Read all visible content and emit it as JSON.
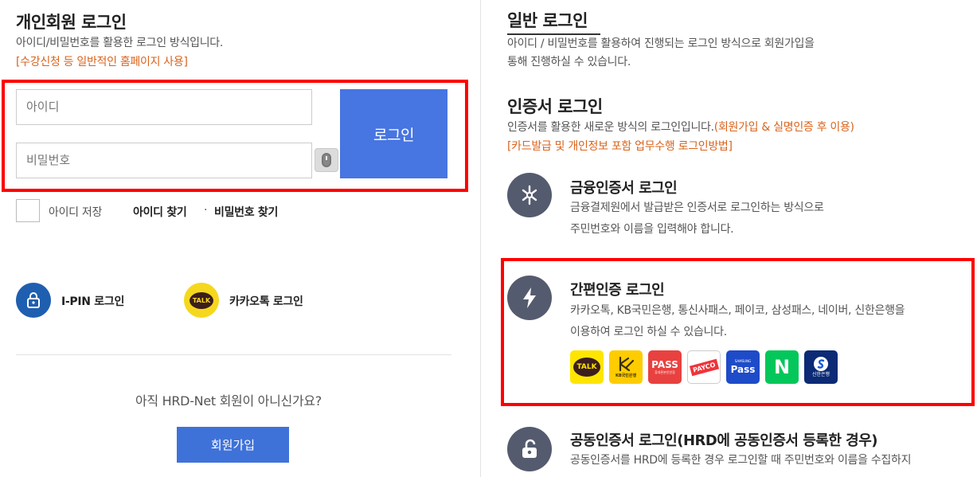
{
  "left": {
    "title": "개인회원 로그인",
    "desc": "아이디/비밀번호를 활용한 로그인 방식입니다.",
    "note": "[수강신청 등 일반적인 홈페이지 사용]",
    "id_placeholder": "아이디",
    "pw_placeholder": "비밀번호",
    "login_label": "로그인",
    "save_id": "아이디 저장",
    "find_id": "아이디 찾기",
    "separator": "·",
    "find_pw": "비밀번호 찾기",
    "ipin_label": "I-PIN 로그인",
    "kakao_label": "카카오톡 로그인",
    "kakao_icon_text": "TALK",
    "not_member": "아직 HRD-Net 회원이 아니신가요?",
    "join_label": "회원가입"
  },
  "right": {
    "general_title": "일반 로그인",
    "general_desc_1": "아이디 / 비밀번호를 활용하여 진행되는 로그인 방식으로 회원가입을",
    "general_desc_2": "통해 진행하실 수 있습니다.",
    "cert_title": "인증서 로그인",
    "cert_desc": "인증서를 활용한 새로운 방식의 로그인입니다.",
    "cert_note": "(회원가입 & 실명인증 후 이용)",
    "cert_note2": "[카드발급 및 개인정보 포함 업무수행 로그인방법]",
    "finance_title": "금융인증서 로그인",
    "finance_desc_1": "금융결제원에서 발급받은 인증서로 로그인하는 방식으로",
    "finance_desc_2": "주민번호와 이름을 입력해야 합니다.",
    "simple_title": "간편인증 로그인",
    "simple_desc_1": "카카오톡, KB국민은행, 통신사패스, 페이코, 삼성패스, 네이버, 신한은행을",
    "simple_desc_2": "이용하여 로그인 하실 수 있습니다.",
    "apps": [
      {
        "name": "kakao",
        "text": "TALK",
        "color": "#fee500"
      },
      {
        "name": "kb",
        "text": "KB국민은행",
        "color": "#ffcc00"
      },
      {
        "name": "pass",
        "text": "PASS",
        "sub": "휴대폰본인인증",
        "color": "#e8413f"
      },
      {
        "name": "payco",
        "text": "PAYCO",
        "color": "#ffffff"
      },
      {
        "name": "samsung-pass",
        "text": "Pass",
        "sub": "SAMSUNG",
        "color": "#1e4bc8"
      },
      {
        "name": "naver",
        "text": "N",
        "color": "#03c75a"
      },
      {
        "name": "shinhan",
        "text": "신한은행",
        "color": "#0c2a75"
      }
    ],
    "public_title": "공동인증서 로그인(HRD에 공동인증서 등록한 경우)",
    "public_desc": "공동인증서를 HRD에 등록한 경우 로그인할 때 주민번호와 이름을 수집하지"
  }
}
